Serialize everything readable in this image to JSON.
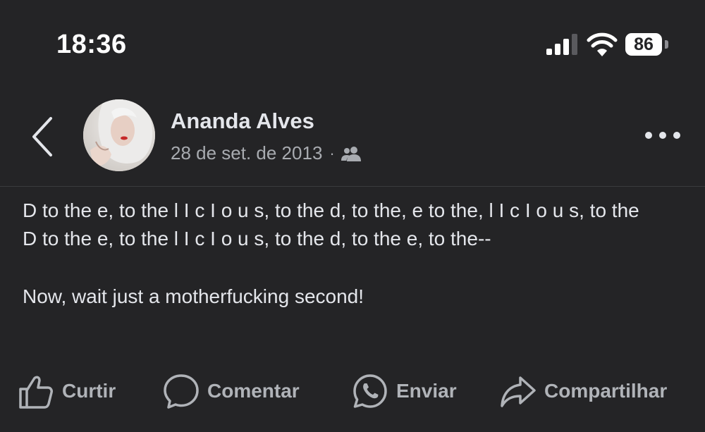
{
  "status_bar": {
    "time": "18:36",
    "battery_level": "86",
    "cellular_signal_bars": 3,
    "cellular_signal_bars_max": 4,
    "icons": [
      "cellular-signal-icon",
      "wifi-icon",
      "battery-icon"
    ]
  },
  "post": {
    "author": "Ananda Alves",
    "date": "28 de set. de 2013",
    "separator": "·",
    "audience_icon": "friends-icon",
    "body_lines": [
      "D to the e, to the l I c I o u s, to the d, to the, e to the, l I c I o u s, to the",
      "D to the e, to the l I c I o u s, to the d, to the e, to the--",
      "",
      "Now, wait just a motherfucking second!"
    ]
  },
  "actions": {
    "like": "Curtir",
    "comment": "Comentar",
    "send": "Enviar",
    "share": "Compartilhar"
  },
  "colors": {
    "background": "#242426",
    "text_primary": "#e4e6eb",
    "text_secondary": "#a8abb0",
    "action_text": "#b0b3b8",
    "divider": "#3a3b3e"
  }
}
